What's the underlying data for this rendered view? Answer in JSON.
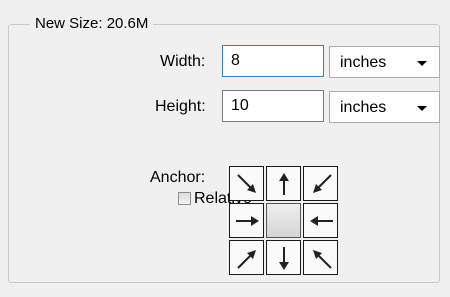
{
  "group": {
    "title": "New Size: 20.6M"
  },
  "width": {
    "label": "Width:",
    "value": "8",
    "unit": "inches"
  },
  "height": {
    "label": "Height:",
    "value": "10",
    "unit": "inches"
  },
  "relative": {
    "label": "Relative",
    "checked": false
  },
  "anchor": {
    "label": "Anchor:",
    "selected": "center",
    "cells": [
      "arrow-southeast-icon",
      "arrow-north-icon",
      "arrow-southwest-icon",
      "arrow-east-icon",
      "anchor-center",
      "arrow-west-icon",
      "arrow-northeast-icon",
      "arrow-south-icon",
      "arrow-northwest-icon"
    ]
  },
  "colors": {
    "focus_border": "#3c7fb1",
    "input_border": "#7a7a7a",
    "background": "#f0f0f0"
  }
}
